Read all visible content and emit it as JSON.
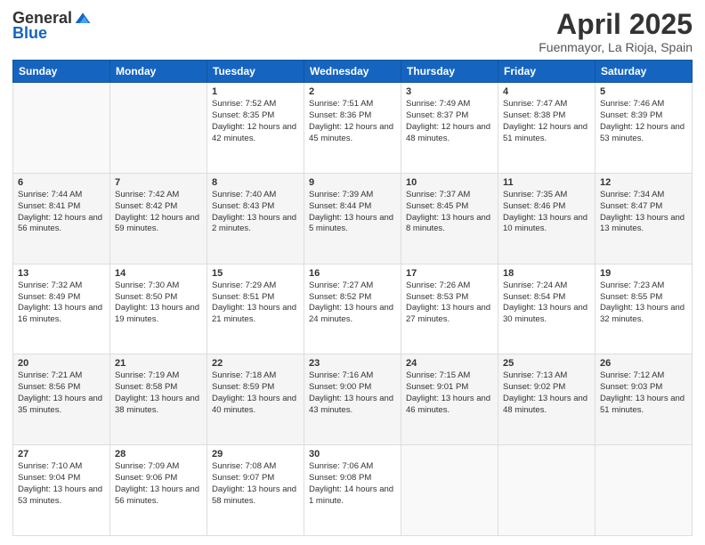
{
  "header": {
    "logo_general": "General",
    "logo_blue": "Blue",
    "month_title": "April 2025",
    "location": "Fuenmayor, La Rioja, Spain"
  },
  "days_of_week": [
    "Sunday",
    "Monday",
    "Tuesday",
    "Wednesday",
    "Thursday",
    "Friday",
    "Saturday"
  ],
  "weeks": [
    [
      {
        "day": "",
        "sunrise": "",
        "sunset": "",
        "daylight": ""
      },
      {
        "day": "",
        "sunrise": "",
        "sunset": "",
        "daylight": ""
      },
      {
        "day": "1",
        "sunrise": "Sunrise: 7:52 AM",
        "sunset": "Sunset: 8:35 PM",
        "daylight": "Daylight: 12 hours and 42 minutes."
      },
      {
        "day": "2",
        "sunrise": "Sunrise: 7:51 AM",
        "sunset": "Sunset: 8:36 PM",
        "daylight": "Daylight: 12 hours and 45 minutes."
      },
      {
        "day": "3",
        "sunrise": "Sunrise: 7:49 AM",
        "sunset": "Sunset: 8:37 PM",
        "daylight": "Daylight: 12 hours and 48 minutes."
      },
      {
        "day": "4",
        "sunrise": "Sunrise: 7:47 AM",
        "sunset": "Sunset: 8:38 PM",
        "daylight": "Daylight: 12 hours and 51 minutes."
      },
      {
        "day": "5",
        "sunrise": "Sunrise: 7:46 AM",
        "sunset": "Sunset: 8:39 PM",
        "daylight": "Daylight: 12 hours and 53 minutes."
      }
    ],
    [
      {
        "day": "6",
        "sunrise": "Sunrise: 7:44 AM",
        "sunset": "Sunset: 8:41 PM",
        "daylight": "Daylight: 12 hours and 56 minutes."
      },
      {
        "day": "7",
        "sunrise": "Sunrise: 7:42 AM",
        "sunset": "Sunset: 8:42 PM",
        "daylight": "Daylight: 12 hours and 59 minutes."
      },
      {
        "day": "8",
        "sunrise": "Sunrise: 7:40 AM",
        "sunset": "Sunset: 8:43 PM",
        "daylight": "Daylight: 13 hours and 2 minutes."
      },
      {
        "day": "9",
        "sunrise": "Sunrise: 7:39 AM",
        "sunset": "Sunset: 8:44 PM",
        "daylight": "Daylight: 13 hours and 5 minutes."
      },
      {
        "day": "10",
        "sunrise": "Sunrise: 7:37 AM",
        "sunset": "Sunset: 8:45 PM",
        "daylight": "Daylight: 13 hours and 8 minutes."
      },
      {
        "day": "11",
        "sunrise": "Sunrise: 7:35 AM",
        "sunset": "Sunset: 8:46 PM",
        "daylight": "Daylight: 13 hours and 10 minutes."
      },
      {
        "day": "12",
        "sunrise": "Sunrise: 7:34 AM",
        "sunset": "Sunset: 8:47 PM",
        "daylight": "Daylight: 13 hours and 13 minutes."
      }
    ],
    [
      {
        "day": "13",
        "sunrise": "Sunrise: 7:32 AM",
        "sunset": "Sunset: 8:49 PM",
        "daylight": "Daylight: 13 hours and 16 minutes."
      },
      {
        "day": "14",
        "sunrise": "Sunrise: 7:30 AM",
        "sunset": "Sunset: 8:50 PM",
        "daylight": "Daylight: 13 hours and 19 minutes."
      },
      {
        "day": "15",
        "sunrise": "Sunrise: 7:29 AM",
        "sunset": "Sunset: 8:51 PM",
        "daylight": "Daylight: 13 hours and 21 minutes."
      },
      {
        "day": "16",
        "sunrise": "Sunrise: 7:27 AM",
        "sunset": "Sunset: 8:52 PM",
        "daylight": "Daylight: 13 hours and 24 minutes."
      },
      {
        "day": "17",
        "sunrise": "Sunrise: 7:26 AM",
        "sunset": "Sunset: 8:53 PM",
        "daylight": "Daylight: 13 hours and 27 minutes."
      },
      {
        "day": "18",
        "sunrise": "Sunrise: 7:24 AM",
        "sunset": "Sunset: 8:54 PM",
        "daylight": "Daylight: 13 hours and 30 minutes."
      },
      {
        "day": "19",
        "sunrise": "Sunrise: 7:23 AM",
        "sunset": "Sunset: 8:55 PM",
        "daylight": "Daylight: 13 hours and 32 minutes."
      }
    ],
    [
      {
        "day": "20",
        "sunrise": "Sunrise: 7:21 AM",
        "sunset": "Sunset: 8:56 PM",
        "daylight": "Daylight: 13 hours and 35 minutes."
      },
      {
        "day": "21",
        "sunrise": "Sunrise: 7:19 AM",
        "sunset": "Sunset: 8:58 PM",
        "daylight": "Daylight: 13 hours and 38 minutes."
      },
      {
        "day": "22",
        "sunrise": "Sunrise: 7:18 AM",
        "sunset": "Sunset: 8:59 PM",
        "daylight": "Daylight: 13 hours and 40 minutes."
      },
      {
        "day": "23",
        "sunrise": "Sunrise: 7:16 AM",
        "sunset": "Sunset: 9:00 PM",
        "daylight": "Daylight: 13 hours and 43 minutes."
      },
      {
        "day": "24",
        "sunrise": "Sunrise: 7:15 AM",
        "sunset": "Sunset: 9:01 PM",
        "daylight": "Daylight: 13 hours and 46 minutes."
      },
      {
        "day": "25",
        "sunrise": "Sunrise: 7:13 AM",
        "sunset": "Sunset: 9:02 PM",
        "daylight": "Daylight: 13 hours and 48 minutes."
      },
      {
        "day": "26",
        "sunrise": "Sunrise: 7:12 AM",
        "sunset": "Sunset: 9:03 PM",
        "daylight": "Daylight: 13 hours and 51 minutes."
      }
    ],
    [
      {
        "day": "27",
        "sunrise": "Sunrise: 7:10 AM",
        "sunset": "Sunset: 9:04 PM",
        "daylight": "Daylight: 13 hours and 53 minutes."
      },
      {
        "day": "28",
        "sunrise": "Sunrise: 7:09 AM",
        "sunset": "Sunset: 9:06 PM",
        "daylight": "Daylight: 13 hours and 56 minutes."
      },
      {
        "day": "29",
        "sunrise": "Sunrise: 7:08 AM",
        "sunset": "Sunset: 9:07 PM",
        "daylight": "Daylight: 13 hours and 58 minutes."
      },
      {
        "day": "30",
        "sunrise": "Sunrise: 7:06 AM",
        "sunset": "Sunset: 9:08 PM",
        "daylight": "Daylight: 14 hours and 1 minute."
      },
      {
        "day": "",
        "sunrise": "",
        "sunset": "",
        "daylight": ""
      },
      {
        "day": "",
        "sunrise": "",
        "sunset": "",
        "daylight": ""
      },
      {
        "day": "",
        "sunrise": "",
        "sunset": "",
        "daylight": ""
      }
    ]
  ]
}
